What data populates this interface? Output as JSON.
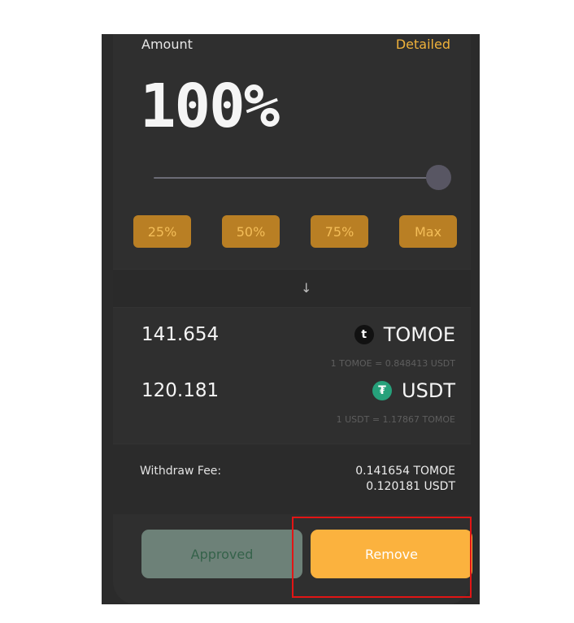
{
  "amount": {
    "label": "Amount",
    "detailed_link": "Detailed",
    "percent_display": "100%",
    "slider_value_percent": 100
  },
  "quick_buttons": [
    "25%",
    "50%",
    "75%",
    "Max"
  ],
  "outputs": [
    {
      "value": "141.654",
      "token": "TOMOE",
      "icon": "tomoe-logo-icon",
      "rate": "1 TOMOE = 0.848413 USDT"
    },
    {
      "value": "120.181",
      "token": "USDT",
      "icon": "tether-logo-icon",
      "rate": "1 USDT = 1.17867 TOMOE"
    }
  ],
  "fee": {
    "label": "Withdraw Fee:",
    "line1": "0.141654 TOMOE",
    "line2": "0.120181 USDT"
  },
  "buttons": {
    "approved": "Approved",
    "remove": "Remove"
  },
  "colors": {
    "accent": "#f0b23a",
    "remove_button": "#fbb23e",
    "approved_button": "#6d8178",
    "highlight": "#e21515"
  }
}
